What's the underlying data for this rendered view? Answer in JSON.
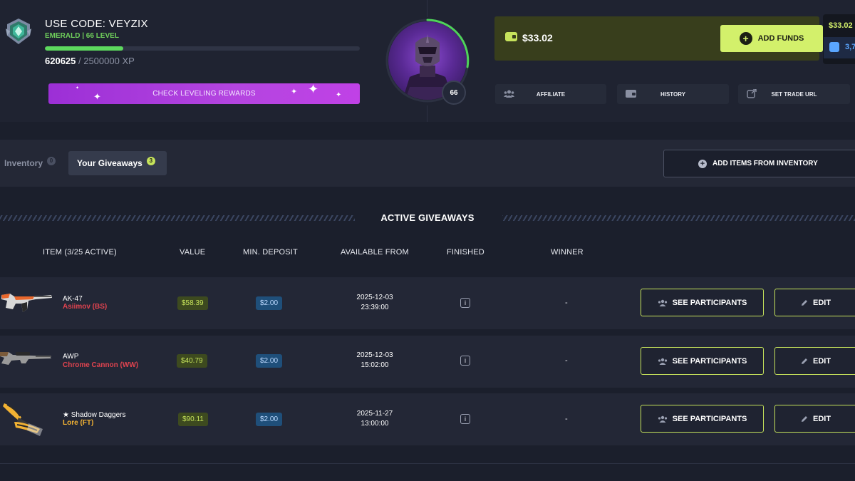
{
  "profile": {
    "use_code": "USE CODE: VEYZIX",
    "level_text": "EMERALD | 66 LEVEL",
    "xp_current": "620625",
    "xp_total": " / 2500000 XP",
    "xp_progress": 0.248,
    "rewards_button": "CHECK LEVELING REWARDS",
    "level_number": "66",
    "rank_icon": "emerald-rank-badge-icon",
    "avatar_icon": "masked-character-avatar"
  },
  "wallet": {
    "balance": "$33.02",
    "add_funds_label": "ADD FUNDS",
    "side_balance": "$33.02",
    "side_gems": "3,7"
  },
  "actions": {
    "affiliate": "AFFILIATE",
    "history": "HISTORY",
    "trade_url": "SET TRADE URL"
  },
  "tabs": {
    "inventory_label": "Inventory",
    "inventory_count": "0",
    "giveaways_label": "Your Giveaways",
    "giveaways_count": "3",
    "add_items_label": "ADD ITEMS FROM INVENTORY"
  },
  "giveaways": {
    "title": "ACTIVE GIVEAWAYS",
    "columns": {
      "item": "ITEM (3/25 ACTIVE)",
      "value": "VALUE",
      "min_deposit": "MIN. DEPOSIT",
      "available_from": "AVAILABLE FROM",
      "finished": "FINISHED",
      "winner": "WINNER"
    },
    "rows": [
      {
        "name": "AK-47",
        "skin": "Asiimov (BS)",
        "skin_color": "#e0434f",
        "value": "$58.39",
        "min_deposit": "$2.00",
        "date": "2025-12-03",
        "time": "23:39:00",
        "winner": "-",
        "participants_label": "SEE PARTICIPANTS",
        "edit_label": "EDIT"
      },
      {
        "name": "AWP",
        "skin": "Chrome Cannon (WW)",
        "skin_color": "#e0434f",
        "value": "$40.79",
        "min_deposit": "$2.00",
        "date": "2025-12-03",
        "time": "15:02:00",
        "winner": "-",
        "participants_label": "SEE PARTICIPANTS",
        "edit_label": "EDIT"
      },
      {
        "name": "★ Shadow Daggers",
        "skin": "Lore (FT)",
        "skin_color": "#f2b233",
        "value": "$90.11",
        "min_deposit": "$2.00",
        "date": "2025-11-27",
        "time": "13:00:00",
        "winner": "-",
        "participants_label": "SEE PARTICIPANTS",
        "edit_label": "EDIT"
      }
    ]
  },
  "colors": {
    "accent_lime": "#c6e35b",
    "accent_purple": "#b445e0",
    "level_green": "#6fcf5b"
  }
}
